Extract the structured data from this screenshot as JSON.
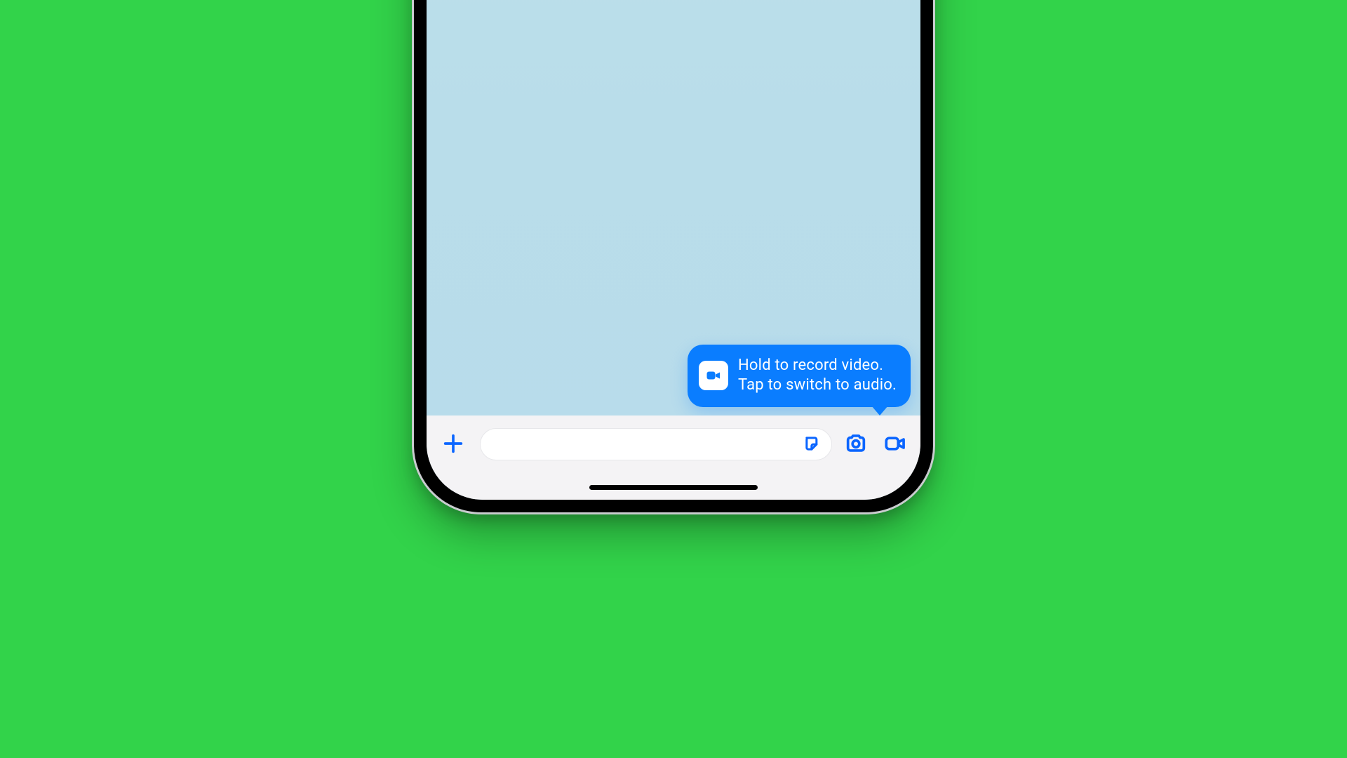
{
  "tooltip": {
    "line1": "Hold to record video.",
    "line2": "Tap to switch to audio.",
    "icon": "video-camera"
  },
  "inputBar": {
    "placeholder": "",
    "icons": {
      "plus": "plus",
      "sticker": "sticker",
      "camera": "camera",
      "video": "video-camera"
    }
  },
  "colors": {
    "accent": "#0a7dff",
    "iconBlue": "#0a65ff",
    "background": "#32d34a"
  }
}
